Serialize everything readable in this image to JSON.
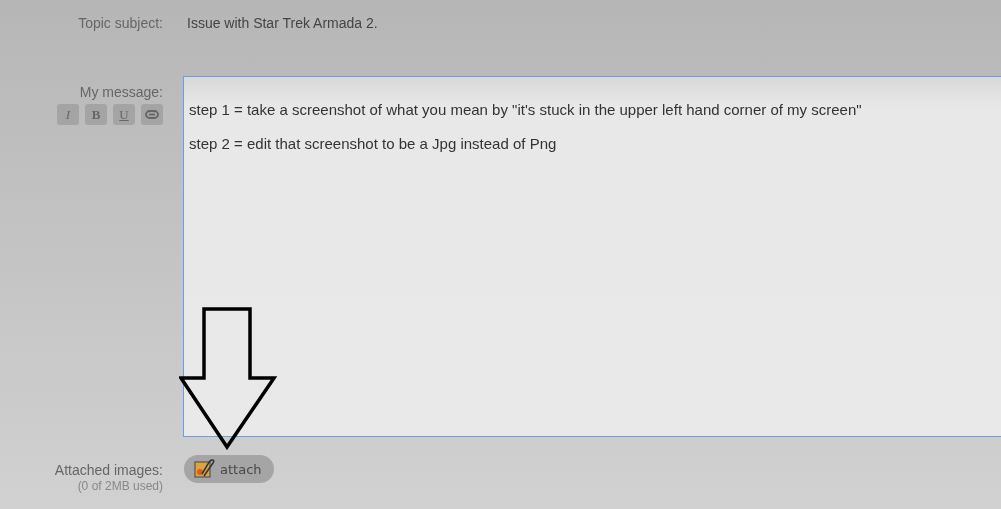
{
  "topic_subject": {
    "label": "Topic subject:",
    "value": "Issue with Star Trek Armada 2."
  },
  "message": {
    "label": "My message:",
    "formatting_buttons": [
      {
        "kind": "italic",
        "label": "I"
      },
      {
        "kind": "bold",
        "label": "B"
      },
      {
        "kind": "underline",
        "label": "U"
      },
      {
        "kind": "link"
      }
    ],
    "lines": [
      "step 1 = take a screenshot of what you mean by \"it's stuck in the upper left hand corner of my screen\"",
      "step 2 = edit that screenshot to be a Jpg instead of Png"
    ]
  },
  "attachments": {
    "label": "Attached images:",
    "usage": "(0 of 2MB used)",
    "button": "attach"
  }
}
